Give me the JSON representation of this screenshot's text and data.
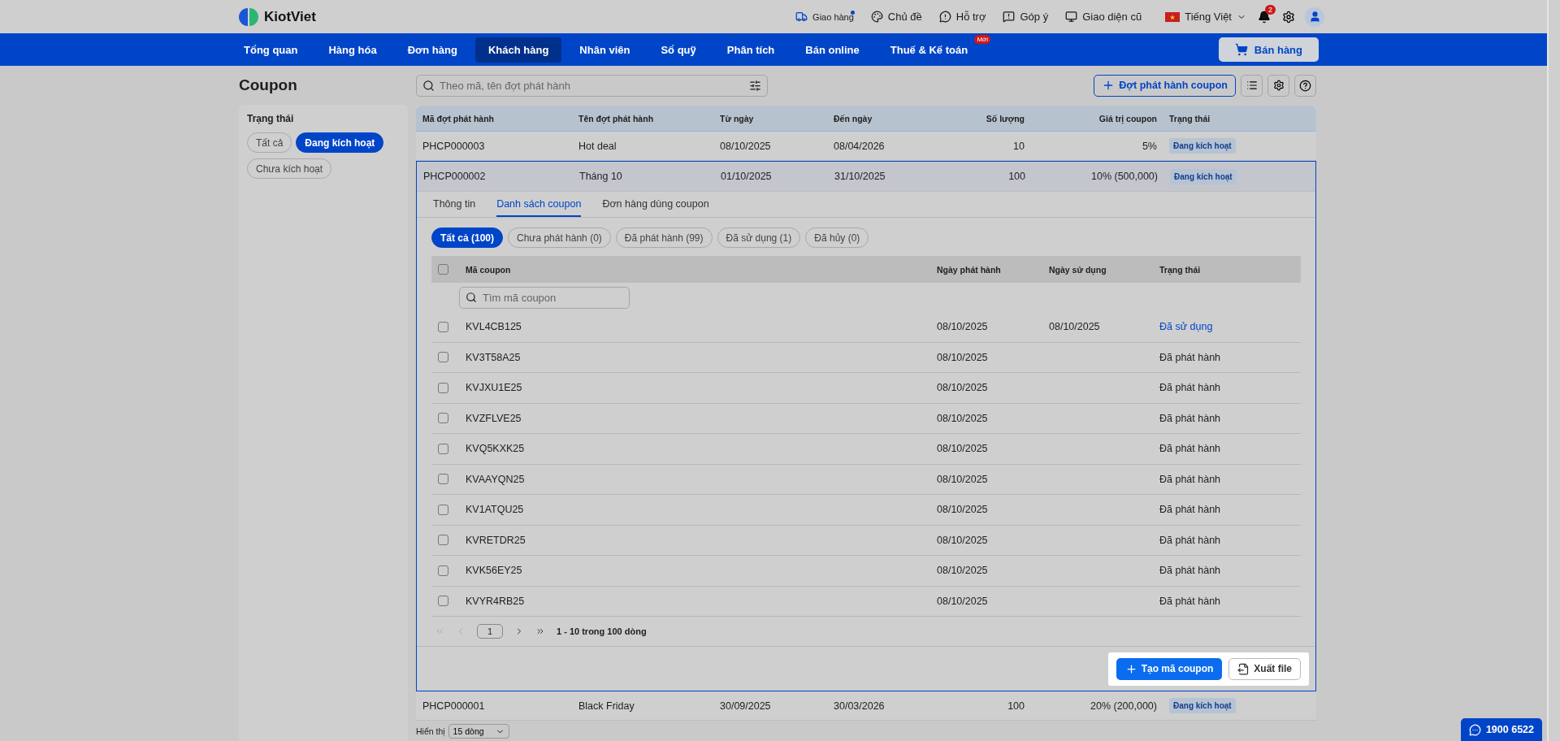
{
  "topbar": {
    "logo": "KiotViet",
    "links": [
      {
        "kind": "delivery",
        "label": "Giao hàng",
        "dot": true
      },
      {
        "kind": "theme",
        "label": "Chủ đề",
        "dot": false
      },
      {
        "kind": "help",
        "label": "Hỗ trợ",
        "dot": false
      },
      {
        "kind": "feedback",
        "label": "Góp ý",
        "dot": false
      },
      {
        "kind": "classic",
        "label": "Giao diện cũ",
        "dot": false
      }
    ],
    "language": "Tiếng Việt",
    "notifications": "2"
  },
  "nav": {
    "items": [
      {
        "label": "Tổng quan",
        "selected": false
      },
      {
        "label": "Hàng hóa",
        "selected": false
      },
      {
        "label": "Đơn hàng",
        "selected": false
      },
      {
        "label": "Khách hàng",
        "selected": true
      },
      {
        "label": "Nhân viên",
        "selected": false
      },
      {
        "label": "Sổ quỹ",
        "selected": false
      },
      {
        "label": "Phân tích",
        "selected": false
      },
      {
        "label": "Bán online",
        "selected": false
      },
      {
        "label": "Thuế & Kế toán",
        "selected": false,
        "badge": "Mới"
      }
    ],
    "sell_button": "Bán hàng"
  },
  "page": {
    "title": "Coupon",
    "search": {
      "placeholder": "Theo mã, tên đợt phát hành"
    },
    "create_button": "Đợt phát hành coupon"
  },
  "sidebar": {
    "heading": "Trạng thái",
    "filters": [
      {
        "label": "Tất cả",
        "selected": false
      },
      {
        "label": "Đang kích hoạt",
        "selected": true
      },
      {
        "label": "Chưa kích hoạt",
        "selected": false
      }
    ]
  },
  "table": {
    "columns": [
      "Mã đợt phát hành",
      "Tên đợt phát hành",
      "Từ ngày",
      "Đến ngày",
      "Số lượng",
      "Giá trị coupon",
      "Trạng thái"
    ],
    "rows": [
      {
        "code": "PHCP000003",
        "name": "Hot deal",
        "from": "08/10/2025",
        "to": "08/04/2026",
        "quantity": "10",
        "value": "5%",
        "status": "Đang kích hoạt",
        "expanded": false
      },
      {
        "code": "PHCP000002",
        "name": "Tháng 10",
        "from": "01/10/2025",
        "to": "31/10/2025",
        "quantity": "100",
        "value": "10% (500,000)",
        "status": "Đang kích hoạt",
        "expanded": true
      },
      {
        "code": "PHCP000001",
        "name": "Black Friday",
        "from": "30/09/2025",
        "to": "30/03/2026",
        "quantity": "100",
        "value": "20% (200,000)",
        "status": "Đang kích hoạt",
        "expanded": false
      }
    ]
  },
  "detail": {
    "tabs": [
      {
        "label": "Thông tin",
        "selected": false
      },
      {
        "label": "Danh sách coupon",
        "selected": true
      },
      {
        "label": "Đơn hàng dùng coupon",
        "selected": false
      }
    ],
    "chips": [
      {
        "label": "Tất cả (100)",
        "selected": true
      },
      {
        "label": "Chưa phát hành (0)",
        "selected": false
      },
      {
        "label": "Đã phát hành (99)",
        "selected": false
      },
      {
        "label": "Đã sử dụng (1)",
        "selected": false
      },
      {
        "label": "Đã hủy (0)",
        "selected": false
      }
    ],
    "columns": [
      "Mã coupon",
      "Ngày phát hành",
      "Ngày sử dụng",
      "Trạng thái"
    ],
    "select_all": {
      "checked": false
    },
    "search": {
      "placeholder": "Tìm mã coupon"
    },
    "coupons": [
      {
        "code": "KVL4CB125",
        "issued": "08/10/2025",
        "used": "08/10/2025",
        "status": "Đã sử dụng",
        "kind": "used",
        "checked": false
      },
      {
        "code": "KV3T58A25",
        "issued": "08/10/2025",
        "status": "Đã phát hành",
        "kind": "issued",
        "checked": false
      },
      {
        "code": "KVJXU1E25",
        "issued": "08/10/2025",
        "status": "Đã phát hành",
        "kind": "issued",
        "checked": false
      },
      {
        "code": "KVZFLVE25",
        "issued": "08/10/2025",
        "status": "Đã phát hành",
        "kind": "issued",
        "checked": false
      },
      {
        "code": "KVQ5KXK25",
        "issued": "08/10/2025",
        "status": "Đã phát hành",
        "kind": "issued",
        "checked": false
      },
      {
        "code": "KVAAYQN25",
        "issued": "08/10/2025",
        "status": "Đã phát hành",
        "kind": "issued",
        "checked": false
      },
      {
        "code": "KV1ATQU25",
        "issued": "08/10/2025",
        "status": "Đã phát hành",
        "kind": "issued",
        "checked": false
      },
      {
        "code": "KVRETDR25",
        "issued": "08/10/2025",
        "status": "Đã phát hành",
        "kind": "issued",
        "checked": false
      },
      {
        "code": "KVK56EY25",
        "issued": "08/10/2025",
        "status": "Đã phát hành",
        "kind": "issued",
        "checked": false
      },
      {
        "code": "KVYR4RB25",
        "issued": "08/10/2025",
        "status": "Đã phát hành",
        "kind": "issued",
        "checked": false
      }
    ],
    "pagination": {
      "page": "1",
      "info": "1 - 10 trong 100 dòng"
    },
    "create_button": "Tạo mã coupon",
    "export_button": "Xuất file"
  },
  "page_size": {
    "label": "Hiển thị",
    "value": "15 dòng"
  },
  "hotline": "1900 6522"
}
